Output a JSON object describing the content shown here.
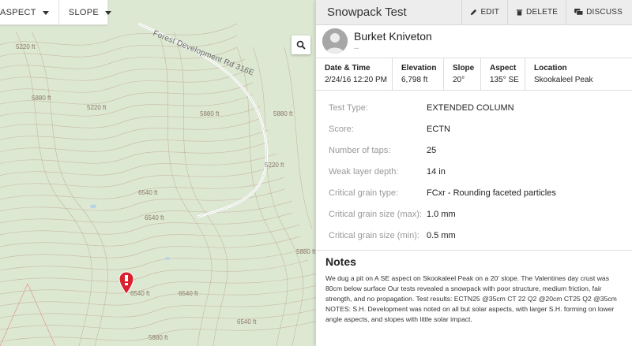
{
  "map": {
    "toolbar": {
      "aspect_label": "ASPECT",
      "slope_label": "SLOPE"
    },
    "road_label": "Forest Development Rd 316E",
    "contour_labels": [
      "5220 ft",
      "5880 ft",
      "5880 ft",
      "6540 ft",
      "6540 ft",
      "6540 ft",
      "6540 ft",
      "5220 ft",
      "5220 ft",
      "5880 ft",
      "5880 ft",
      "5880 ft",
      "6540 ft"
    ],
    "search_icon": "search-icon",
    "marker_icon": "observation-marker-icon"
  },
  "panel": {
    "title": "Snowpack Test",
    "actions": {
      "edit_label": "EDIT",
      "delete_label": "DELETE",
      "discuss_label": "DISCUSS"
    },
    "user": {
      "name": "Burket Kniveton",
      "subtitle": "--"
    },
    "meta": [
      {
        "label": "Date & Time",
        "value": "2/24/16 12:20 PM"
      },
      {
        "label": "Elevation",
        "value": "6,798 ft"
      },
      {
        "label": "Slope",
        "value": "20°"
      },
      {
        "label": "Aspect",
        "value": "135° SE"
      },
      {
        "label": "Location",
        "value": "Skookaleel Peak"
      }
    ],
    "details": [
      {
        "label": "Test Type:",
        "value": "EXTENDED COLUMN"
      },
      {
        "label": "Score:",
        "value": "ECTN"
      },
      {
        "label": "Number of taps:",
        "value": "25"
      },
      {
        "label": "Weak layer depth:",
        "value": "14 in"
      },
      {
        "label": "Critical grain type:",
        "value": "FCxr - Rounding faceted particles"
      },
      {
        "label": "Critical grain size (max):",
        "value": "1.0 mm"
      },
      {
        "label": "Critical grain size (min):",
        "value": "0.5 mm"
      }
    ],
    "notes": {
      "title": "Notes",
      "text": "We dug a pit on A SE aspect on Skookaleel Peak on a 20' slope. The Valentines day crust was 80cm below surface Our tests revealed a snowpack with poor structure, medium friction, fair strength, and no propagation. Test results: ECTN25 @35cm CT 22 Q2 @20cm CT25 Q2 @35cm NOTES: S.H. Development was noted on all but solar aspects, with larger S.H. forming on lower angle aspects, and slopes with little solar impact."
    }
  },
  "colors": {
    "map_bg": "#dde8d3",
    "contour": "#b9a68e",
    "road": "#ffffff",
    "marker": "#d8232f",
    "panel_header_bg": "#ededed"
  }
}
